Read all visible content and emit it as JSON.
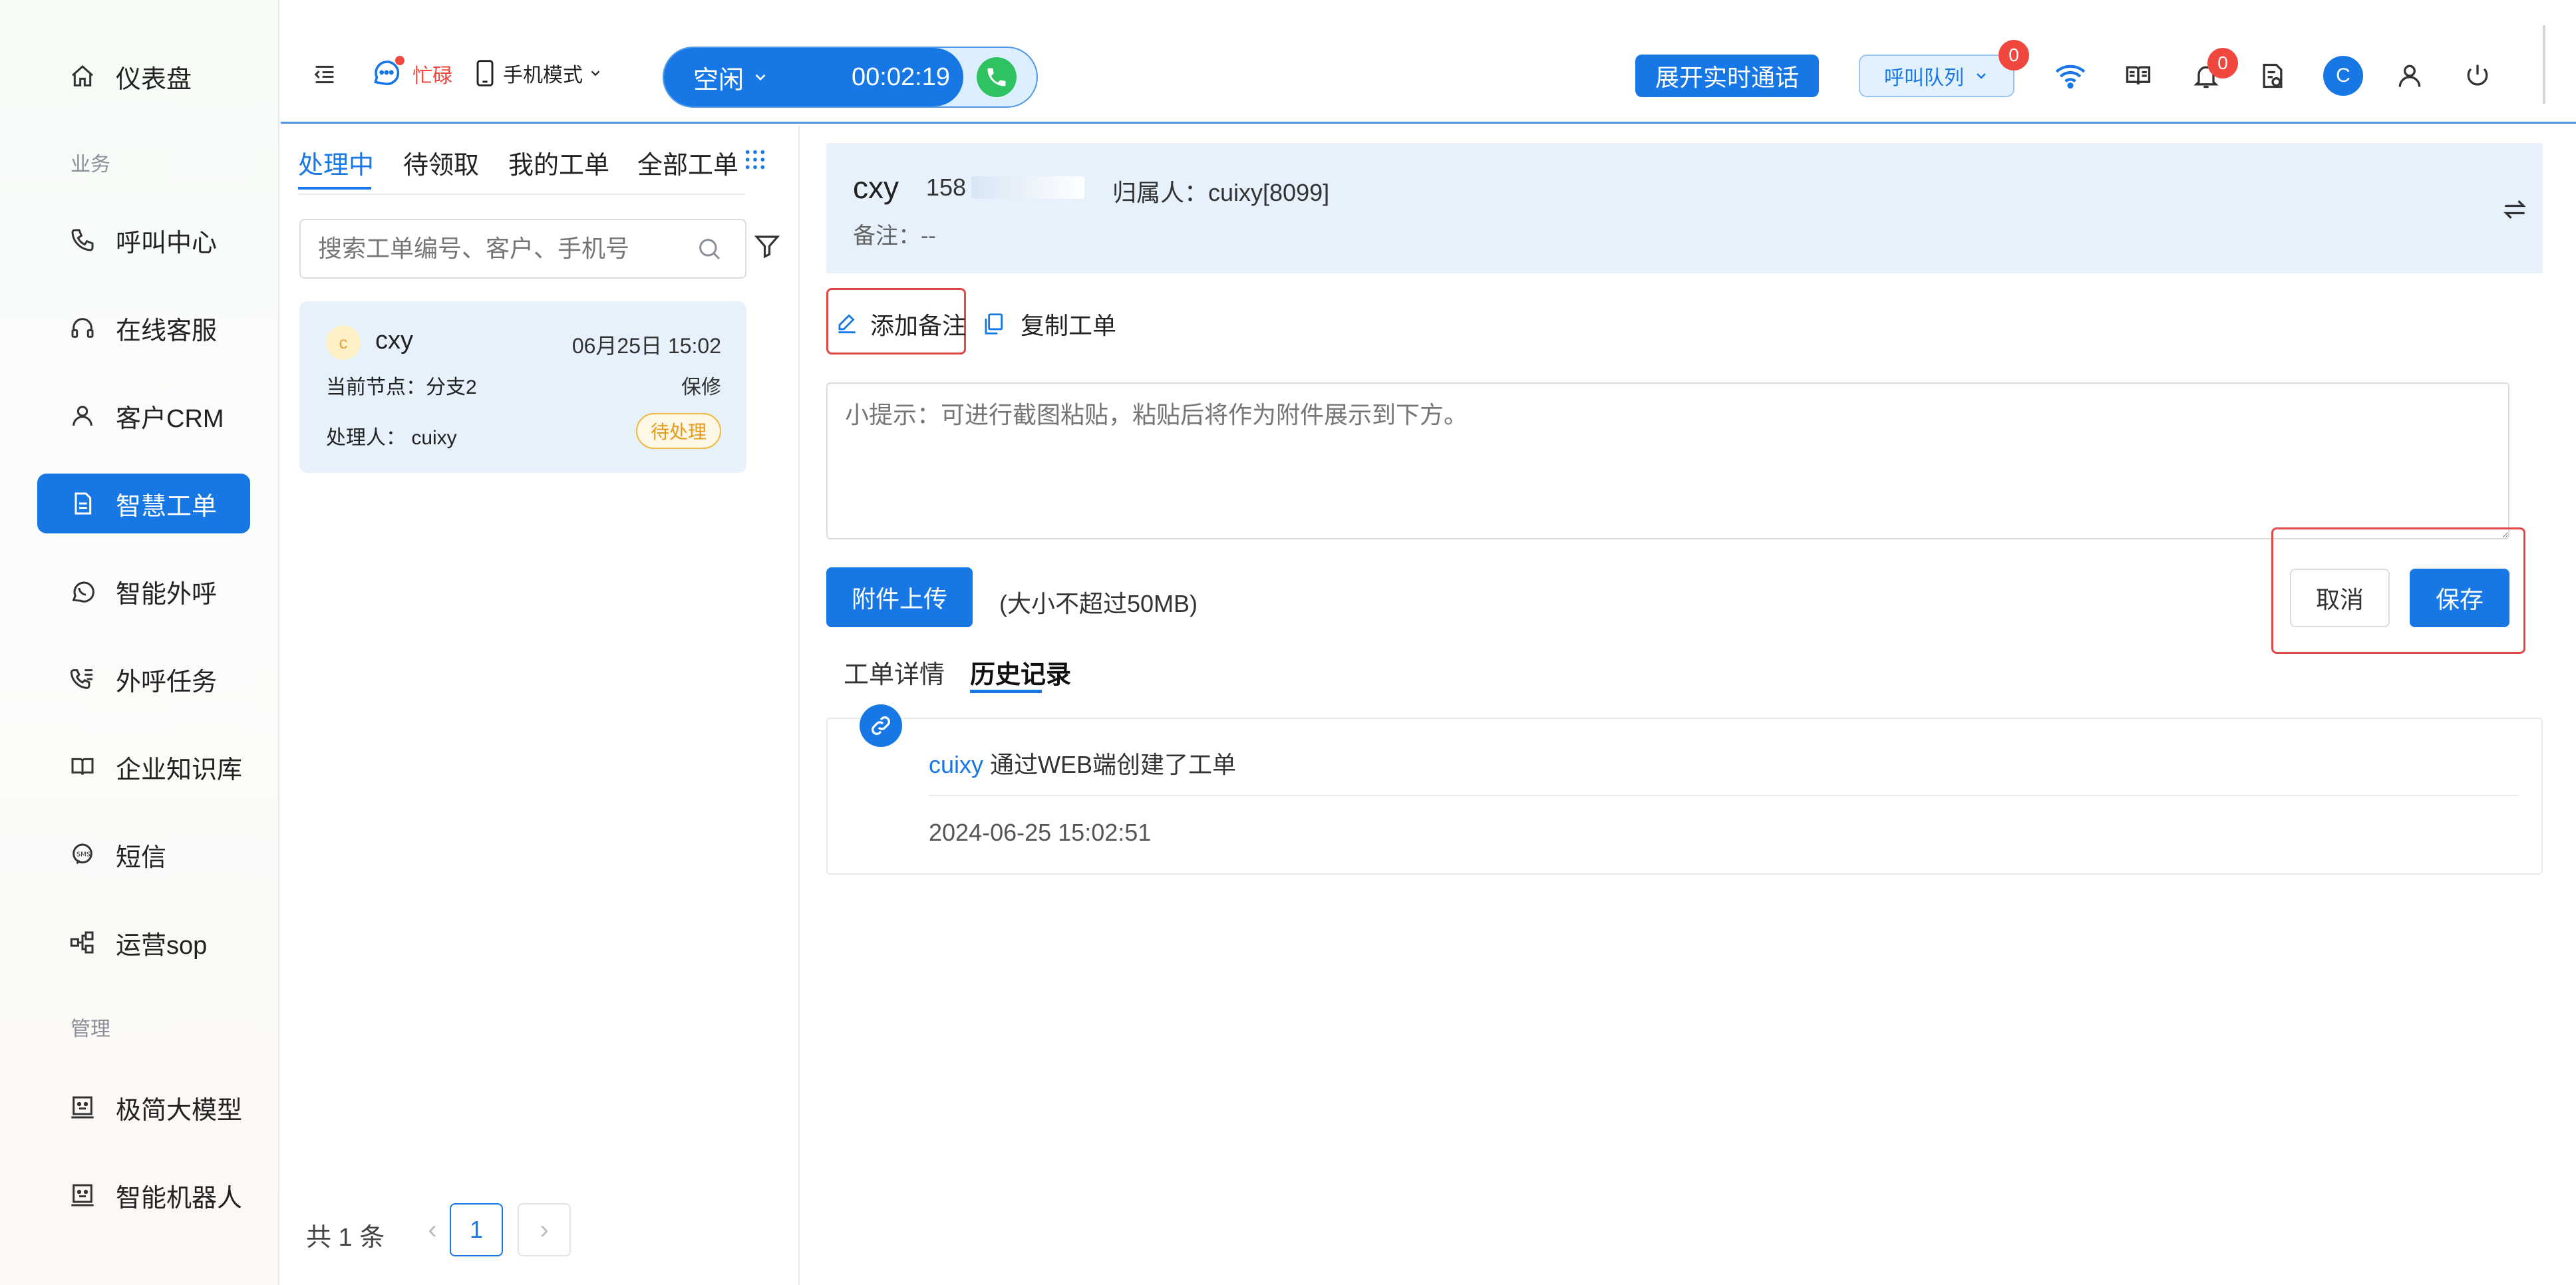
{
  "sidebar": {
    "items": [
      {
        "label": "仪表盘",
        "icon": "home-icon"
      },
      {
        "label": "呼叫中心",
        "icon": "phone-icon"
      },
      {
        "label": "在线客服",
        "icon": "headset-icon"
      },
      {
        "label": "客户CRM",
        "icon": "user-icon"
      },
      {
        "label": "智慧工单",
        "icon": "document-icon"
      },
      {
        "label": "智能外呼",
        "icon": "whatsapp-icon"
      },
      {
        "label": "外呼任务",
        "icon": "call-list-icon"
      },
      {
        "label": "企业知识库",
        "icon": "book-icon"
      },
      {
        "label": "短信",
        "icon": "sms-icon"
      },
      {
        "label": "运营sop",
        "icon": "flow-icon"
      },
      {
        "label": "极简大模型",
        "icon": "robot-icon"
      },
      {
        "label": "智能机器人",
        "icon": "robot-icon"
      }
    ],
    "sections": {
      "business": "业务",
      "manage": "管理"
    }
  },
  "header": {
    "status_busy": "忙碌",
    "mode": "手机模式",
    "call_status": "空闲",
    "call_timer": "00:02:19",
    "realtime_call": "展开实时通话",
    "queue_label": "呼叫队列",
    "queue_badge": "0",
    "notify_badge": "0",
    "avatar_letter": "C",
    "accent": "#1677e5"
  },
  "list": {
    "tabs": [
      "处理中",
      "待领取",
      "我的工单",
      "全部工单"
    ],
    "search_placeholder": "搜索工单编号、客户、手机号",
    "ticket": {
      "avatar": "c",
      "name": "cxy",
      "time": "06月25日 15:02",
      "node": "当前节点：分支2",
      "type": "保修",
      "handler": "处理人： cuixy",
      "status": "待处理"
    },
    "pagination": {
      "total": "共 1 条",
      "page": "1",
      "prev": "‹",
      "next": "›"
    }
  },
  "detail": {
    "customer_name": "cxy",
    "phone": "158",
    "owner": "归属人：cuixy[8099]",
    "remark": "备注：--",
    "add_remark": "添加备注",
    "copy_ticket": "复制工单",
    "textarea_placeholder": "小提示：可进行截图粘贴，粘贴后将作为附件展示到下方。",
    "upload_btn": "附件上传",
    "upload_hint": "(大小不超过50MB)",
    "cancel": "取消",
    "save": "保存",
    "tabs": [
      "工单详情",
      "历史记录"
    ],
    "history": {
      "user": "cuixy",
      "action": " 通过WEB端创建了工单",
      "time": "2024-06-25 15:02:51"
    }
  }
}
